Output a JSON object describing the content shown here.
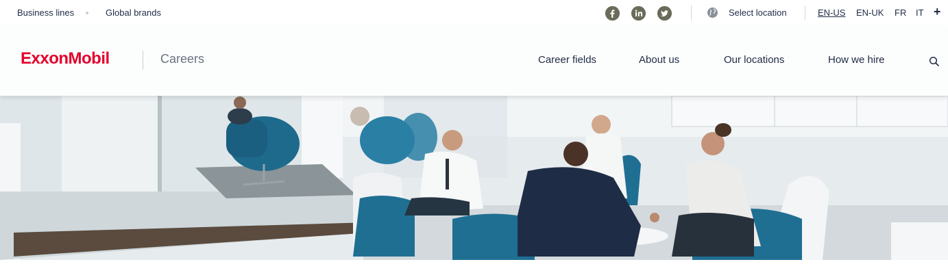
{
  "utility": {
    "business_lines": "Business lines",
    "global_brands": "Global brands",
    "social": [
      "facebook-icon",
      "linkedin-icon",
      "twitter-icon"
    ],
    "select_location": "Select location",
    "languages": [
      "EN-US",
      "EN-UK",
      "FR",
      "IT"
    ],
    "active_language": "EN-US",
    "more": "+"
  },
  "header": {
    "logo": "ExxonMobil",
    "section": "Careers",
    "nav": [
      "Career fields",
      "About us",
      "Our locations",
      "How we hire"
    ]
  },
  "hero": {
    "image": "office-meeting-photo"
  },
  "colors": {
    "brand_red": "#e4002b",
    "text_navy": "#1f2a44",
    "social_gray": "#6b6b5a",
    "chair_teal": "#1f6f93"
  }
}
